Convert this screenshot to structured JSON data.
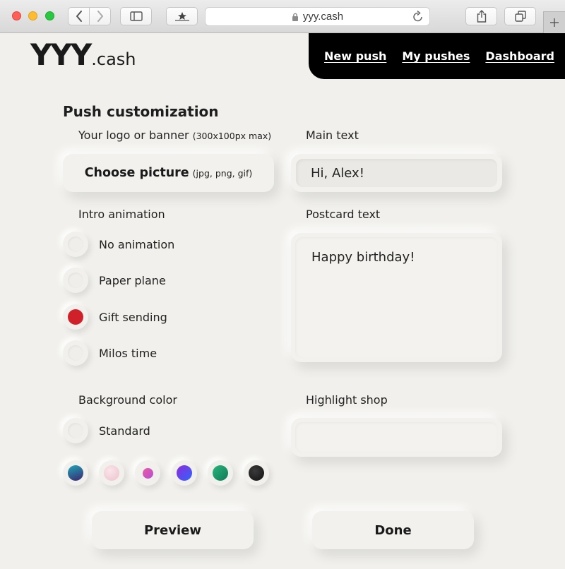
{
  "browser": {
    "url": "yyy.cash"
  },
  "header": {
    "logo_main": "YYY",
    "logo_suffix": ".cash",
    "nav": [
      {
        "label": "New push"
      },
      {
        "label": "My pushes"
      },
      {
        "label": "Dashboard"
      }
    ]
  },
  "form": {
    "title": "Push customization",
    "logo_label": "Your logo or banner",
    "logo_hint": "(300x100px max)",
    "choose_label": "Choose picture",
    "choose_hint": "(jpg, png, gif)",
    "main_text_label": "Main text",
    "main_text_value": "Hi, Alex!",
    "intro_label": "Intro animation",
    "animations": [
      {
        "label": "No animation",
        "selected": false
      },
      {
        "label": "Paper plane",
        "selected": false
      },
      {
        "label": "Gift sending",
        "selected": true
      },
      {
        "label": "Milos time",
        "selected": false
      }
    ],
    "postcard_label": "Postcard text",
    "postcard_value": "Happy birthday!",
    "bg_label": "Background color",
    "bg_standard_label": "Standard",
    "swatches": [
      {
        "name": "teal-navy",
        "color_a": "#1e9fb4",
        "color_b": "#3a2a6e"
      },
      {
        "name": "blush",
        "color_a": "#f5c6d0",
        "color_b": "#e7d8e3"
      },
      {
        "name": "pink-purple",
        "color_a": "#e85aa6",
        "color_b": "#b04fd0"
      },
      {
        "name": "violet-blue",
        "color_a": "#8a2be2",
        "color_b": "#3b5bff"
      },
      {
        "name": "green",
        "color_a": "#1ea672",
        "color_b": "#0f7f5a"
      },
      {
        "name": "black",
        "color_a": "#333333",
        "color_b": "#111111"
      }
    ],
    "highlight_label": "Highlight shop",
    "highlight_value": "",
    "preview_label": "Preview",
    "done_label": "Done"
  },
  "colors": {
    "background": "#f1f0ec",
    "selected_radio": "#d0202a",
    "nav_background": "#000000"
  }
}
